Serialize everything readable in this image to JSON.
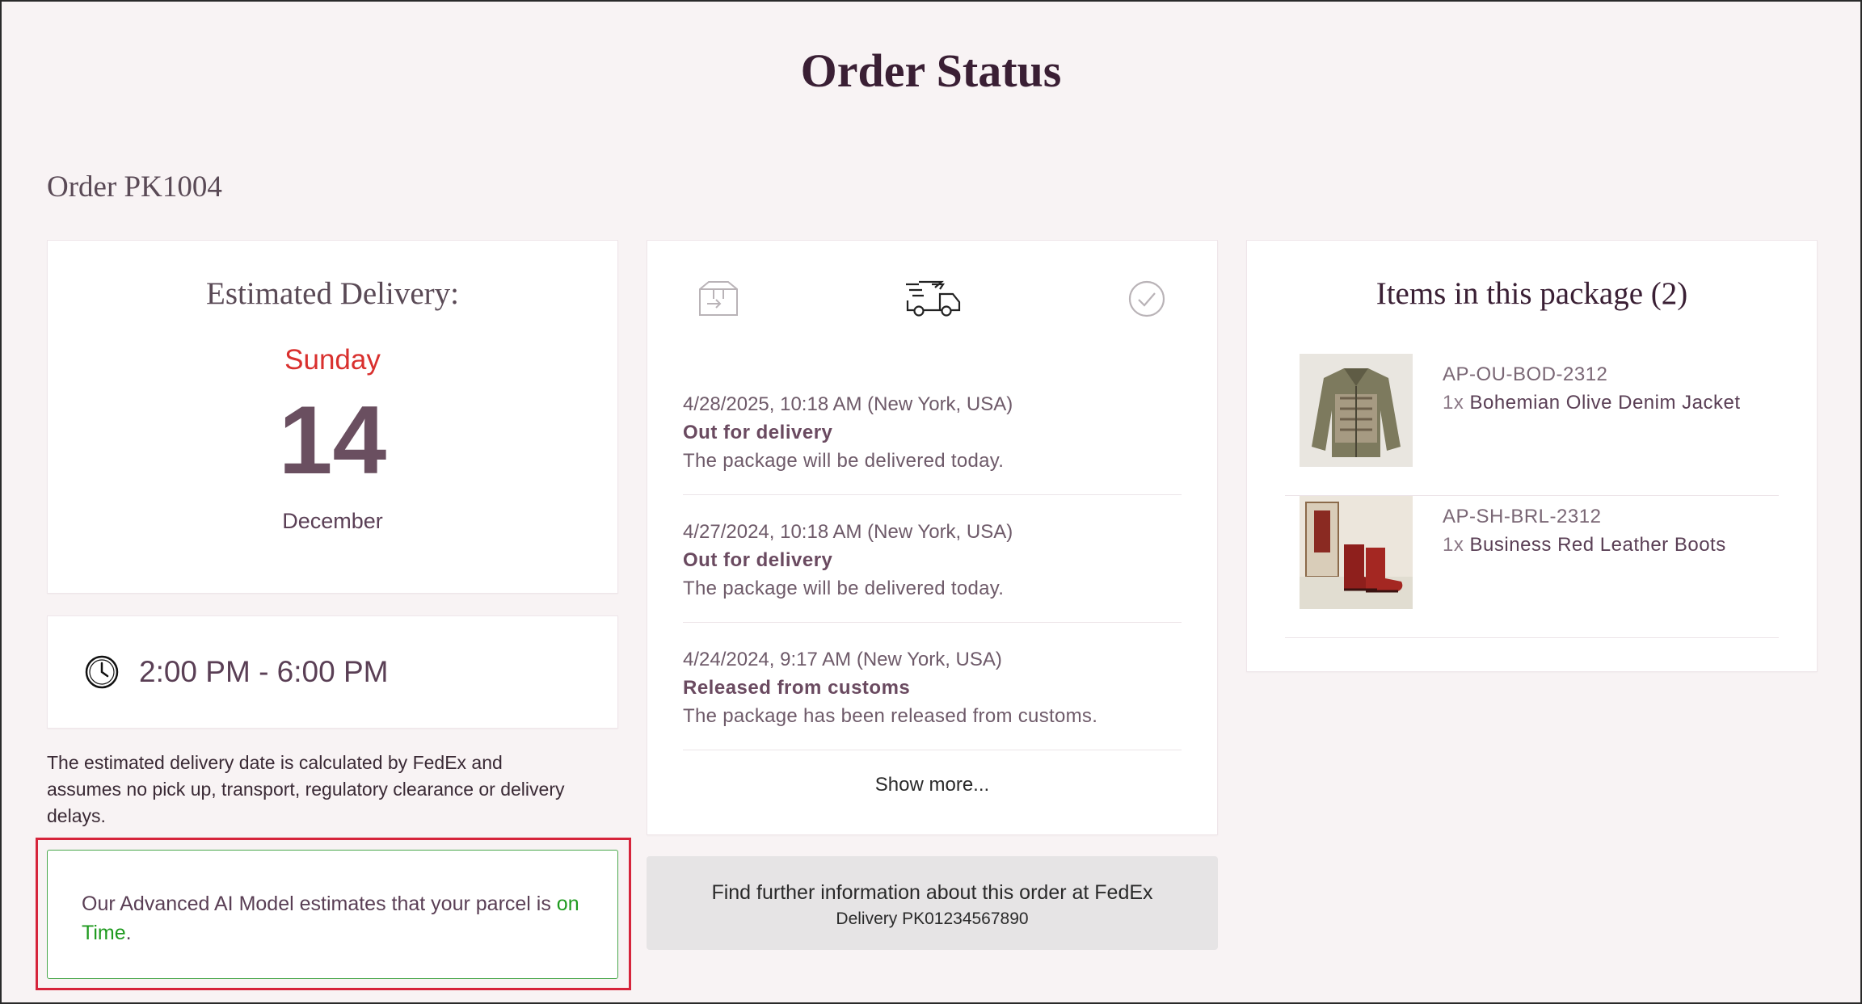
{
  "page": {
    "title": "Order Status",
    "order_label": "Order PK1004"
  },
  "estimate": {
    "heading": "Estimated Delivery:",
    "weekday": "Sunday",
    "day": "14",
    "month": "December",
    "time_window": "2:00 PM - 6:00 PM",
    "disclaimer": "The estimated delivery date is calculated by FedEx and assumes no pick up, transport, regulatory clearance or delivery delays."
  },
  "ai_estimate": {
    "text_prefix": "Our Advanced AI Model estimates that your parcel is ",
    "status": "on Time",
    "suffix": "."
  },
  "tracking": {
    "step_icons": [
      "box-icon",
      "delivery-truck-icon",
      "check-circle-icon"
    ],
    "events": [
      {
        "timestamp": "4/28/2025, 10:18 AM (New York, USA)",
        "title": "Out for delivery",
        "description": "The package will be delivered today."
      },
      {
        "timestamp": "4/27/2024, 10:18 AM (New York, USA)",
        "title": "Out for delivery",
        "description": "The package will be delivered today."
      },
      {
        "timestamp": "4/24/2024, 9:17 AM (New York, USA)",
        "title": "Released from customs",
        "description": "The package has been released from customs."
      }
    ],
    "show_more": "Show more..."
  },
  "fedex": {
    "line1": "Find further information about this order at FedEx",
    "line2": "Delivery PK01234567890"
  },
  "items": {
    "heading": "Items in this package (2)",
    "list": [
      {
        "sku": "AP-OU-BOD-2312",
        "qty": "1x",
        "name": "Bohemian Olive Denim Jacket"
      },
      {
        "sku": "AP-SH-BRL-2312",
        "qty": "1x",
        "name": "Business Red Leather Boots"
      }
    ]
  },
  "colors": {
    "accent_red": "#d9302e",
    "on_time_green": "#1f9a1f",
    "highlight_border": "#d6243b"
  }
}
